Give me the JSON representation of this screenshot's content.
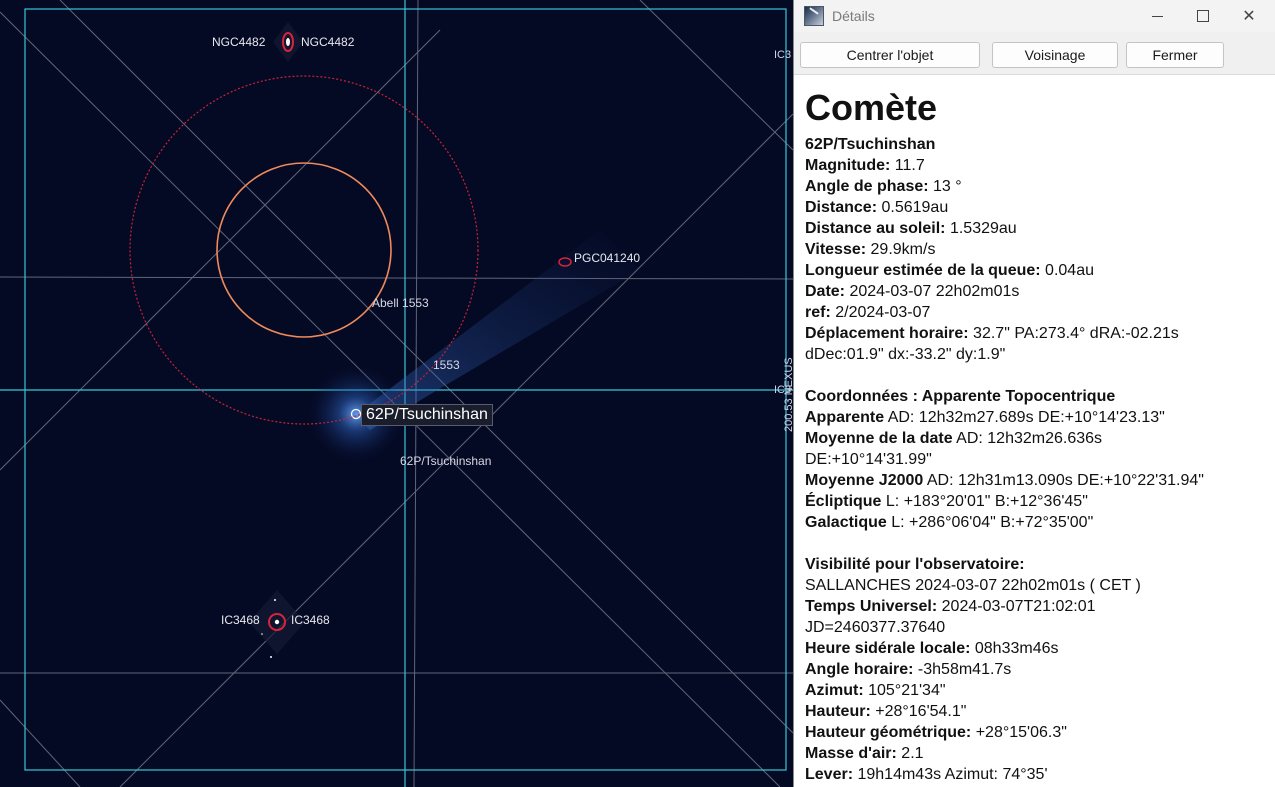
{
  "sky": {
    "labels": {
      "ngc_left": "NGC4482",
      "ngc_right": "NGC4482",
      "ic_left": "IC3468",
      "ic_right": "IC3468",
      "pgc": "PGC041240",
      "abell": "Abell 1553",
      "num1553": "1553",
      "comet_small": "62P/Tsuchinshan",
      "comet_tag": "62P/Tsuchinshan",
      "edge_top": "IC3",
      "edge_mid": "IC3",
      "vertical": "200.53 NEXUS"
    },
    "colors": {
      "background": "#050a24",
      "frame": "#38c6d8",
      "grid": "#7f8496",
      "circle_outer": "#c8223a",
      "circle_inner": "#f08a5b"
    }
  },
  "window": {
    "title": "Détails",
    "app_icon": "app-icon",
    "controls": {
      "minimize": "minimize-icon",
      "maximize": "maximize-icon",
      "close": "✕"
    },
    "buttons": {
      "center": "Centrer l'objet",
      "neighborhood": "Voisinage",
      "close": "Fermer"
    },
    "heading": "Comète",
    "name": "62P/Tsuchinshan",
    "rows": [
      {
        "label": "Magnitude:",
        "value": " 11.7"
      },
      {
        "label": "Angle de phase:",
        "value": " 13 °"
      },
      {
        "label": "Distance:",
        "value": " 0.5619au"
      },
      {
        "label": "Distance au soleil:",
        "value": " 1.5329au"
      },
      {
        "label": "Vitesse:",
        "value": " 29.9km/s"
      },
      {
        "label": "Longueur estimée de la queue:",
        "value": " 0.04au"
      },
      {
        "label": "Date:",
        "value": " 2024-03-07 22h02m01s"
      },
      {
        "label": "ref:",
        "value": " 2/2024-03-07"
      },
      {
        "label": "Déplacement horaire:",
        "value": " 32.7\" PA:273.4° dRA:-02.21s"
      },
      {
        "label": "",
        "value": "dDec:01.9\" dx:-33.2\" dy:1.9\""
      }
    ],
    "coords": [
      {
        "label": "Coordonnées : Apparente Topocentrique",
        "value": ""
      },
      {
        "label": "Apparente",
        "value": " AD: 12h32m27.689s DE:+10°14'23.13\""
      },
      {
        "label": "Moyenne de la date",
        "value": " AD: 12h32m26.636s"
      },
      {
        "label": "",
        "value": "DE:+10°14'31.99\""
      },
      {
        "label": "Moyenne J2000",
        "value": " AD: 12h31m13.090s DE:+10°22'31.94\""
      },
      {
        "label": "Écliptique",
        "value": "  L: +183°20'01\" B:+12°36'45\""
      },
      {
        "label": "Galactique",
        "value": "  L: +286°06'04\" B:+72°35'00\""
      }
    ],
    "visibility": [
      {
        "label": "Visibilité pour l'observatoire:",
        "value": ""
      },
      {
        "label": "",
        "value": "SALLANCHES 2024-03-07 22h02m01s ( CET )"
      },
      {
        "label": "Temps Universel:",
        "value": " 2024-03-07T21:02:01"
      },
      {
        "label": "",
        "value": "JD=2460377.37640"
      },
      {
        "label": "Heure sidérale locale:",
        "value": " 08h33m46s"
      },
      {
        "label": "Angle horaire:",
        "value": "  -3h58m41.7s"
      },
      {
        "label": "Azimut:",
        "value": " 105°21'34\""
      },
      {
        "label": "Hauteur:",
        "value": " +28°16'54.1\""
      },
      {
        "label": "Hauteur géométrique:",
        "value": " +28°15'06.3\""
      },
      {
        "label": "Masse d'air:",
        "value": " 2.1"
      },
      {
        "label": "Lever:",
        "value": " 19h14m43s Azimut: 74°35'"
      }
    ]
  }
}
